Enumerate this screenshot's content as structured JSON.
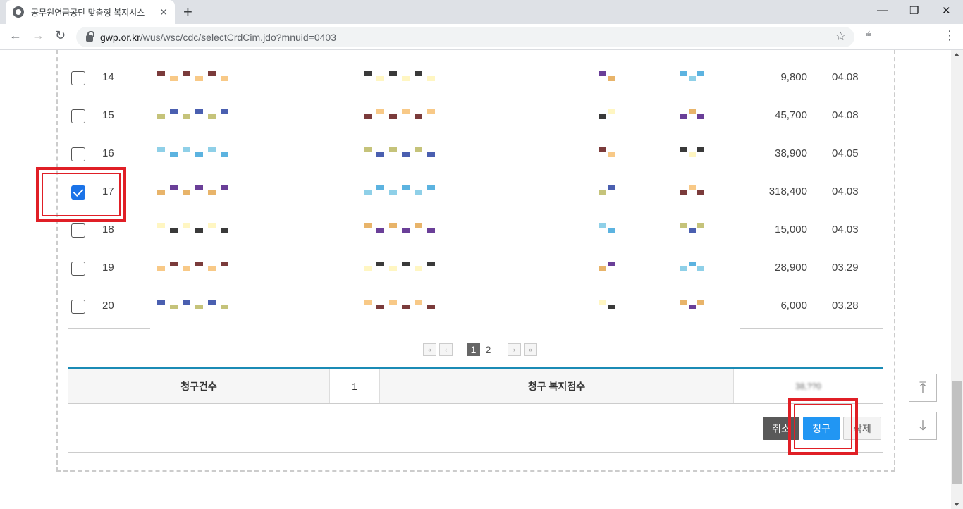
{
  "browser": {
    "tab_title": "공무원연금공단 맞춤형 복지시스",
    "url_host": "gwp.or.kr",
    "url_path": "/wus/wsc/cdc/selectCrdCim.jdo?mnuid=0403",
    "icons": {
      "back": "←",
      "forward": "→",
      "reload": "↻",
      "star": "☆",
      "menu": "⋮",
      "close": "✕",
      "newtab": "+",
      "minimize": "—",
      "restore": "❐",
      "win_close": "✕"
    }
  },
  "rows": [
    {
      "num": "14",
      "amount": "9,800",
      "date": "04.08",
      "checked": false
    },
    {
      "num": "15",
      "amount": "45,700",
      "date": "04.08",
      "checked": false
    },
    {
      "num": "16",
      "amount": "38,900",
      "date": "04.05",
      "checked": false
    },
    {
      "num": "17",
      "amount": "318,400",
      "date": "04.03",
      "checked": true
    },
    {
      "num": "18",
      "amount": "15,000",
      "date": "04.03",
      "checked": false
    },
    {
      "num": "19",
      "amount": "28,900",
      "date": "03.29",
      "checked": false
    },
    {
      "num": "20",
      "amount": "6,000",
      "date": "03.28",
      "checked": false
    }
  ],
  "pager": {
    "pages": [
      "1",
      "2"
    ],
    "current": "1",
    "first": "«",
    "prev": "‹",
    "next": "›",
    "last": "»"
  },
  "summary": {
    "count_label": "청구건수",
    "count_value": "1",
    "points_label": "청구 복지점수",
    "points_value": "38,??0"
  },
  "buttons": {
    "cancel": "취소",
    "claim": "청구",
    "delete": "삭제"
  },
  "side": {
    "top_icon": "⤒",
    "bottom_icon": "⤓"
  },
  "colors": {
    "accent": "#2196f3",
    "highlight": "#e01f26",
    "table_border": "#1a8bb5"
  }
}
